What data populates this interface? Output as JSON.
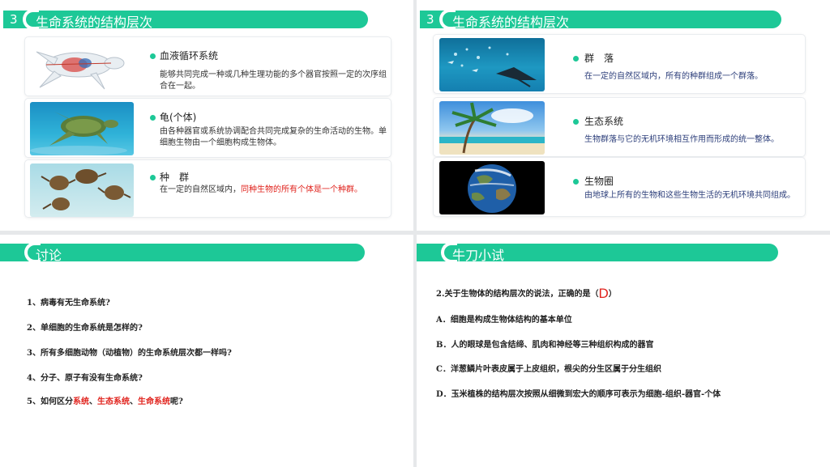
{
  "colors": {
    "accent": "#1dc897",
    "red": "#e0221c",
    "blue_text": "#2c3e7a"
  },
  "slide1": {
    "number": "3",
    "title": "生命系统的结构层次",
    "cards": [
      {
        "icon": "turtle-anatomy-image",
        "title": "血液循环系统",
        "desc": "能够共同完成一种或几种生理功能的多个器官按照一定的次序组合在一起。"
      },
      {
        "icon": "sea-turtle-image",
        "title": "龟(个体)",
        "desc": "由各种器官或系统协调配合共同完成复杂的生命活动的生物。单细胞生物由一个细胞构成生物体。"
      },
      {
        "icon": "turtle-group-image",
        "title": "种　群",
        "desc_plain": "在一定的自然区域内，",
        "desc_red": "同种生物的所有个体是一个种群。"
      }
    ]
  },
  "slide2": {
    "number": "3",
    "title": "生命系统的结构层次",
    "cards": [
      {
        "icon": "ocean-community-image",
        "title": "群　落",
        "desc": "在一定的自然区域内，所有的种群组成一个群落。"
      },
      {
        "icon": "beach-palm-image",
        "title": "生态系统",
        "desc": "生物群落与它的无机环境相互作用而形成的统一整体。"
      },
      {
        "icon": "earth-image",
        "title": "生物圈",
        "desc": "由地球上所有的生物和这些生物生活的无机环境共同组成。"
      }
    ]
  },
  "slide3": {
    "title": "讨论",
    "questions": [
      "1、病毒有无生命系统?",
      "2、单细胞的生命系统是怎样的?",
      "3、所有多细胞动物（动植物）的生命系统层次都一样吗?",
      "4、分子、原子有没有生命系统?"
    ],
    "q5": {
      "prefix": "5、如何区分",
      "t1": "系统",
      "sep1": "、",
      "t2": "生态系统",
      "sep2": "、",
      "t3": "生命系统",
      "suffix": "呢?"
    }
  },
  "slide4": {
    "title": "牛刀小试",
    "question_prefix": "2.关于生物体的结构层次的说法，正确的是（",
    "answer": "D",
    "question_suffix": "）",
    "options": [
      "A．细胞是构成生物体结构的基本单位",
      "B．人的眼球是包含结缔、肌肉和神经等三种组织构成的器官",
      "C．洋葱鳞片叶表皮属于上皮组织，根尖的分生区属于分生组织",
      "D．玉米植株的结构层次按照从细微到宏大的顺序可表示为细胞-组织-器官-个体"
    ]
  }
}
